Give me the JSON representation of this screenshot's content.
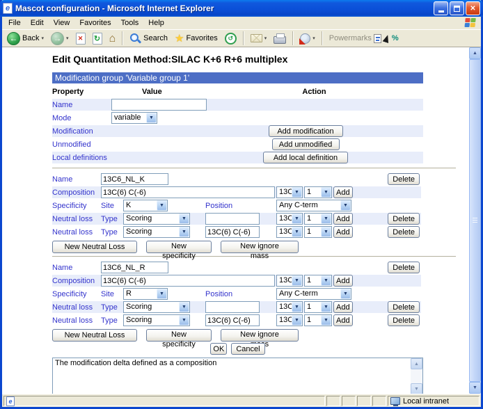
{
  "window": {
    "title": "Mascot configuration - Microsoft Internet Explorer"
  },
  "icons": {
    "ie_logo": "e",
    "close": "✕",
    "back": "←",
    "forward": "→",
    "stop": "✕",
    "refresh": "↻",
    "home": "⌂",
    "favorites_star": "★",
    "history": "↺",
    "caret": "▾",
    "select_arrow": "▼",
    "scroll_up": "▲",
    "scroll_down": "▼",
    "percent": "%"
  },
  "menu": {
    "items": [
      "File",
      "Edit",
      "View",
      "Favorites",
      "Tools",
      "Help"
    ]
  },
  "toolbar": {
    "back_label": "Back",
    "search_label": "Search",
    "favorites_label": "Favorites",
    "powermarks_label": "Powermarks"
  },
  "page": {
    "heading": "Edit Quantitation Method:SILAC K+6 R+6 multiplex",
    "banner": "Modification group 'Variable group 1'",
    "header": {
      "property": "Property",
      "value": "Value",
      "action": "Action"
    },
    "group": {
      "name_label": "Name",
      "name_value": "",
      "mode_label": "Mode",
      "mode_value": "variable",
      "modification_label": "Modification",
      "add_modification_label": "Add modification",
      "unmodified_label": "Unmodified",
      "add_unmodified_label": "Add unmodified",
      "local_definitions_label": "Local definitions",
      "add_local_definition_label": "Add local definition"
    },
    "mods": [
      {
        "name_label": "Name",
        "name_value": "13C6_NL_K",
        "delete_label": "Delete",
        "composition_label": "Composition",
        "composition_value": "13C(6) C(-6)",
        "element_value": "13C",
        "count_value": "1",
        "add_label": "Add",
        "specificity_label": "Specificity",
        "site_label": "Site",
        "site_value": "K",
        "position_label": "Position",
        "position_value": "Any C-term",
        "nl": [
          {
            "label": "Neutral loss",
            "type_label": "Type",
            "type_value": "Scoring",
            "composition_value": "",
            "element_value": "13C",
            "count_value": "1",
            "add_label": "Add",
            "delete_label": "Delete"
          },
          {
            "label": "Neutral loss",
            "type_label": "Type",
            "type_value": "Scoring",
            "composition_value": "13C(6) C(-6)",
            "element_value": "13C",
            "count_value": "1",
            "add_label": "Add",
            "delete_label": "Delete"
          }
        ],
        "new_neutral_loss_label": "New Neutral Loss",
        "new_specificity_label": "New specificity",
        "new_ignore_mass_label": "New ignore mass"
      },
      {
        "name_label": "Name",
        "name_value": "13C6_NL_R",
        "delete_label": "Delete",
        "composition_label": "Composition",
        "composition_value": "13C(6) C(-6)",
        "element_value": "13C",
        "count_value": "1",
        "add_label": "Add",
        "specificity_label": "Specificity",
        "site_label": "Site",
        "site_value": "R",
        "position_label": "Position",
        "position_value": "Any C-term",
        "nl": [
          {
            "label": "Neutral loss",
            "type_label": "Type",
            "type_value": "Scoring",
            "composition_value": "",
            "element_value": "13C",
            "count_value": "1",
            "add_label": "Add",
            "delete_label": "Delete"
          },
          {
            "label": "Neutral loss",
            "type_label": "Type",
            "type_value": "Scoring",
            "composition_value": "13C(6) C(-6)",
            "element_value": "13C",
            "count_value": "1",
            "add_label": "Add",
            "delete_label": "Delete"
          }
        ],
        "new_neutral_loss_label": "New Neutral Loss",
        "new_specificity_label": "New specificity",
        "new_ignore_mass_label": "New ignore mass"
      }
    ],
    "ok_label": "OK",
    "cancel_label": "Cancel",
    "description": "The modification delta defined as a composition"
  },
  "statusbar": {
    "zone_label": "Local intranet"
  }
}
